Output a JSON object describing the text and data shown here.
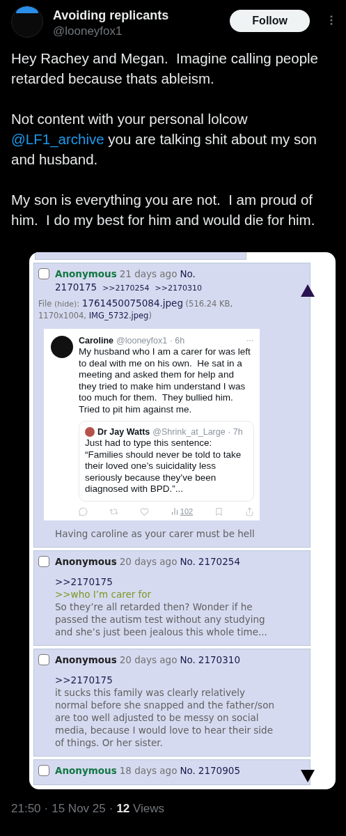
{
  "author": {
    "name": "Avoiding replicants",
    "handle": "@looneyfox1"
  },
  "follow_button": "Follow",
  "tweet_paragraphs": [
    [
      {
        "text": "Hey Rachey and Megan.  Imagine calling people retarded because thats ableism."
      }
    ],
    [
      {
        "text": "Not content with your personal lolcow "
      },
      {
        "text": "@LF1_archive",
        "kind": "link"
      },
      {
        "text": " you are talking shit about my son and husband."
      }
    ],
    [
      {
        "text": "My son is everything you are not.  I am proud of him.  I do my best for him and would die for him."
      }
    ]
  ],
  "posts": [
    {
      "kind": "partial"
    },
    {
      "kind": "full",
      "checked": false,
      "name": "Anonymous",
      "color": "#117743",
      "date": "21 days ago",
      "no_label": "No.",
      "number": "2170175",
      "backlinks": [
        ">>2170254",
        ">>2170310"
      ],
      "file": [
        {
          "text": "File "
        },
        {
          "text": "(hide)",
          "kind": "link"
        },
        {
          "text": ": "
        },
        {
          "text": "1761450075084.jpeg",
          "kind": "filename"
        },
        {
          "text": " (516.24 KB, 1170x1004, "
        },
        {
          "text": "IMG_5732.jpeg",
          "kind": "filename"
        },
        {
          "text": ")"
        }
      ],
      "screenshot": {
        "author": "Caroline",
        "meta": "@looneyfox1 · 6h",
        "text": "My husband who I am a carer for was left to deal with me on his own.  He sat in a meeting and asked them for help and they tried to make him understand I was too much for them.  They bullied him.  Tried to pit him against me.",
        "quote": {
          "author": "Dr Jay Watts",
          "meta": "@Shrink_at_Large · 7h",
          "text": "Just had to type this sentence: “Families should never be told to take their loved one’s suicidality less seriously because they’ve been diagnosed with BPD.”..."
        },
        "views": "102"
      },
      "comment": [
        {
          "kind": "text",
          "text": "Having caroline as your carer must be hell"
        }
      ]
    },
    {
      "kind": "full",
      "checked": false,
      "name": "Anonymous",
      "color": "#222222",
      "date": "20 days ago",
      "no_label": "No.",
      "number": "2170254",
      "comment": [
        {
          "kind": "reply",
          "text": ">>2170175"
        },
        {
          "kind": "greentext",
          "text": ">>who I’m carer for"
        },
        {
          "kind": "text",
          "text": "So they’re all retarded then? Wonder if he passed the autism test without any studying and she’s just been jealous this whole time..."
        }
      ]
    },
    {
      "kind": "full",
      "checked": false,
      "name": "Anonymous",
      "color": "#222222",
      "date": "20 days ago",
      "no_label": "No.",
      "number": "2170310",
      "comment": [
        {
          "kind": "reply",
          "text": ">>2170175"
        },
        {
          "kind": "text",
          "text": "it sucks this family was clearly relatively normal before she snapped and the father/son are too well adjusted to be messy on social media, because I would love to hear their side of things. Or her sister."
        }
      ]
    },
    {
      "kind": "cut",
      "checked": false,
      "name": "Anonymous",
      "color": "#117743",
      "date": "18 days ago",
      "no_label": "No.",
      "number": "2170905"
    }
  ],
  "footer": {
    "time": "21:50",
    "separator": "·",
    "date": "15 Nov 25",
    "views_count": "12",
    "views_label": "Views"
  }
}
